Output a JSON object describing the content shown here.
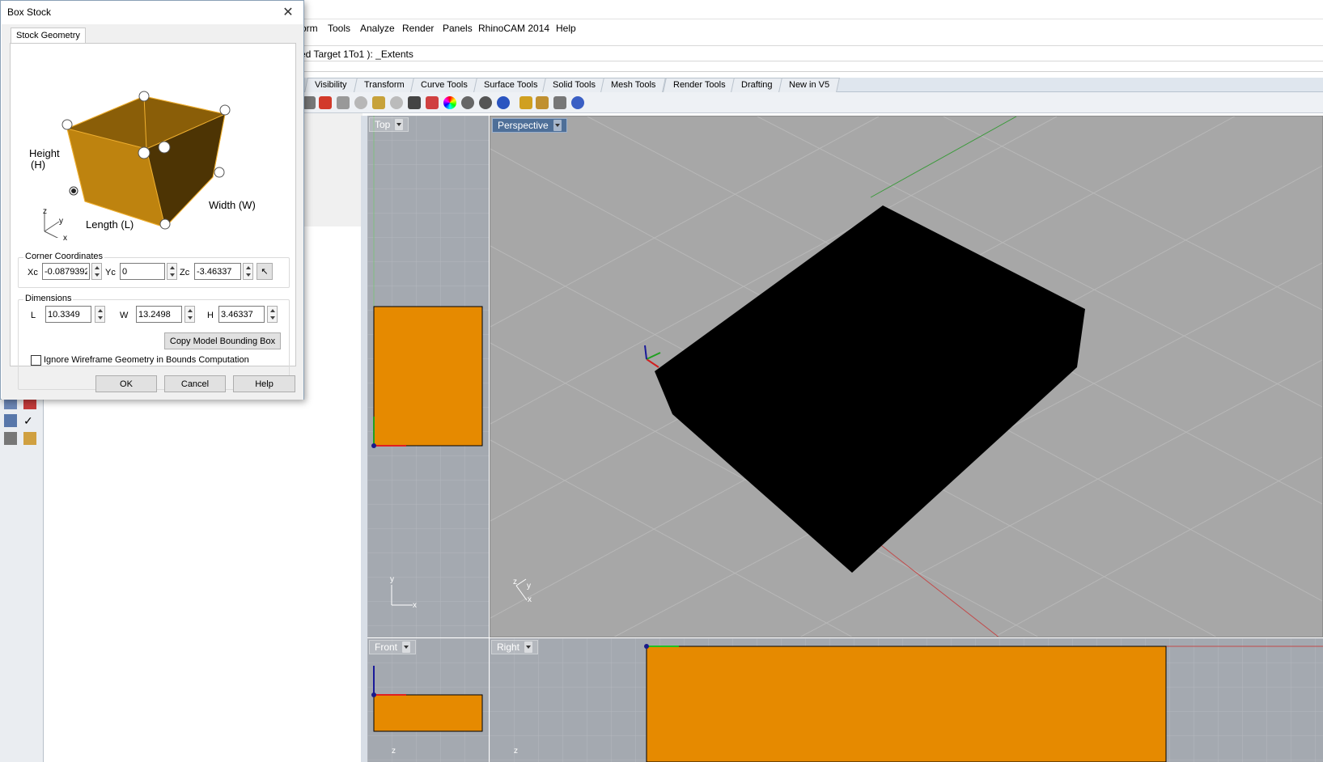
{
  "menu": {
    "items": [
      "orm",
      "Tools",
      "Analyze",
      "Render",
      "Panels",
      "RhinoCAM 2014",
      "Help"
    ]
  },
  "command": {
    "text": "ed  Target  1To1 ): _Extents"
  },
  "toolbar_tabs": [
    "Visibility",
    "Transform",
    "Curve Tools",
    "Surface Tools",
    "Solid Tools",
    "Mesh Tools",
    "Render Tools",
    "Drafting",
    "New in V5"
  ],
  "viewports": {
    "top": "Top",
    "perspective": "Perspective",
    "front": "Front",
    "right": "Right"
  },
  "axis_labels": {
    "x": "x",
    "y": "y",
    "z": "z"
  },
  "dialog": {
    "title": "Box Stock",
    "tab": "Stock Geometry",
    "diagram": {
      "height_label_1": "Height",
      "height_label_2": "(H)",
      "width_label": "Width (W)",
      "length_label": "Length (L)"
    },
    "corner_group": "Corner Coordinates",
    "xc_label": "Xc",
    "xc_value": "-0.0879392",
    "yc_label": "Yc",
    "yc_value": "0",
    "zc_label": "Zc",
    "zc_value": "-3.46337",
    "dims_group": "Dimensions",
    "l_label": "L",
    "l_value": "10.3349",
    "w_label": "W",
    "w_value": "13.2498",
    "h_label": "H",
    "h_value": "3.46337",
    "copy_button": "Copy Model Bounding Box",
    "ignore_checkbox": "Ignore Wireframe Geometry in Bounds Computation",
    "ok": "OK",
    "cancel": "Cancel",
    "help": "Help"
  },
  "colors": {
    "stock_orange": "#e68a00",
    "viewport_bg": "#a7a7a7",
    "active_viewport_label": "#4e6f98"
  }
}
